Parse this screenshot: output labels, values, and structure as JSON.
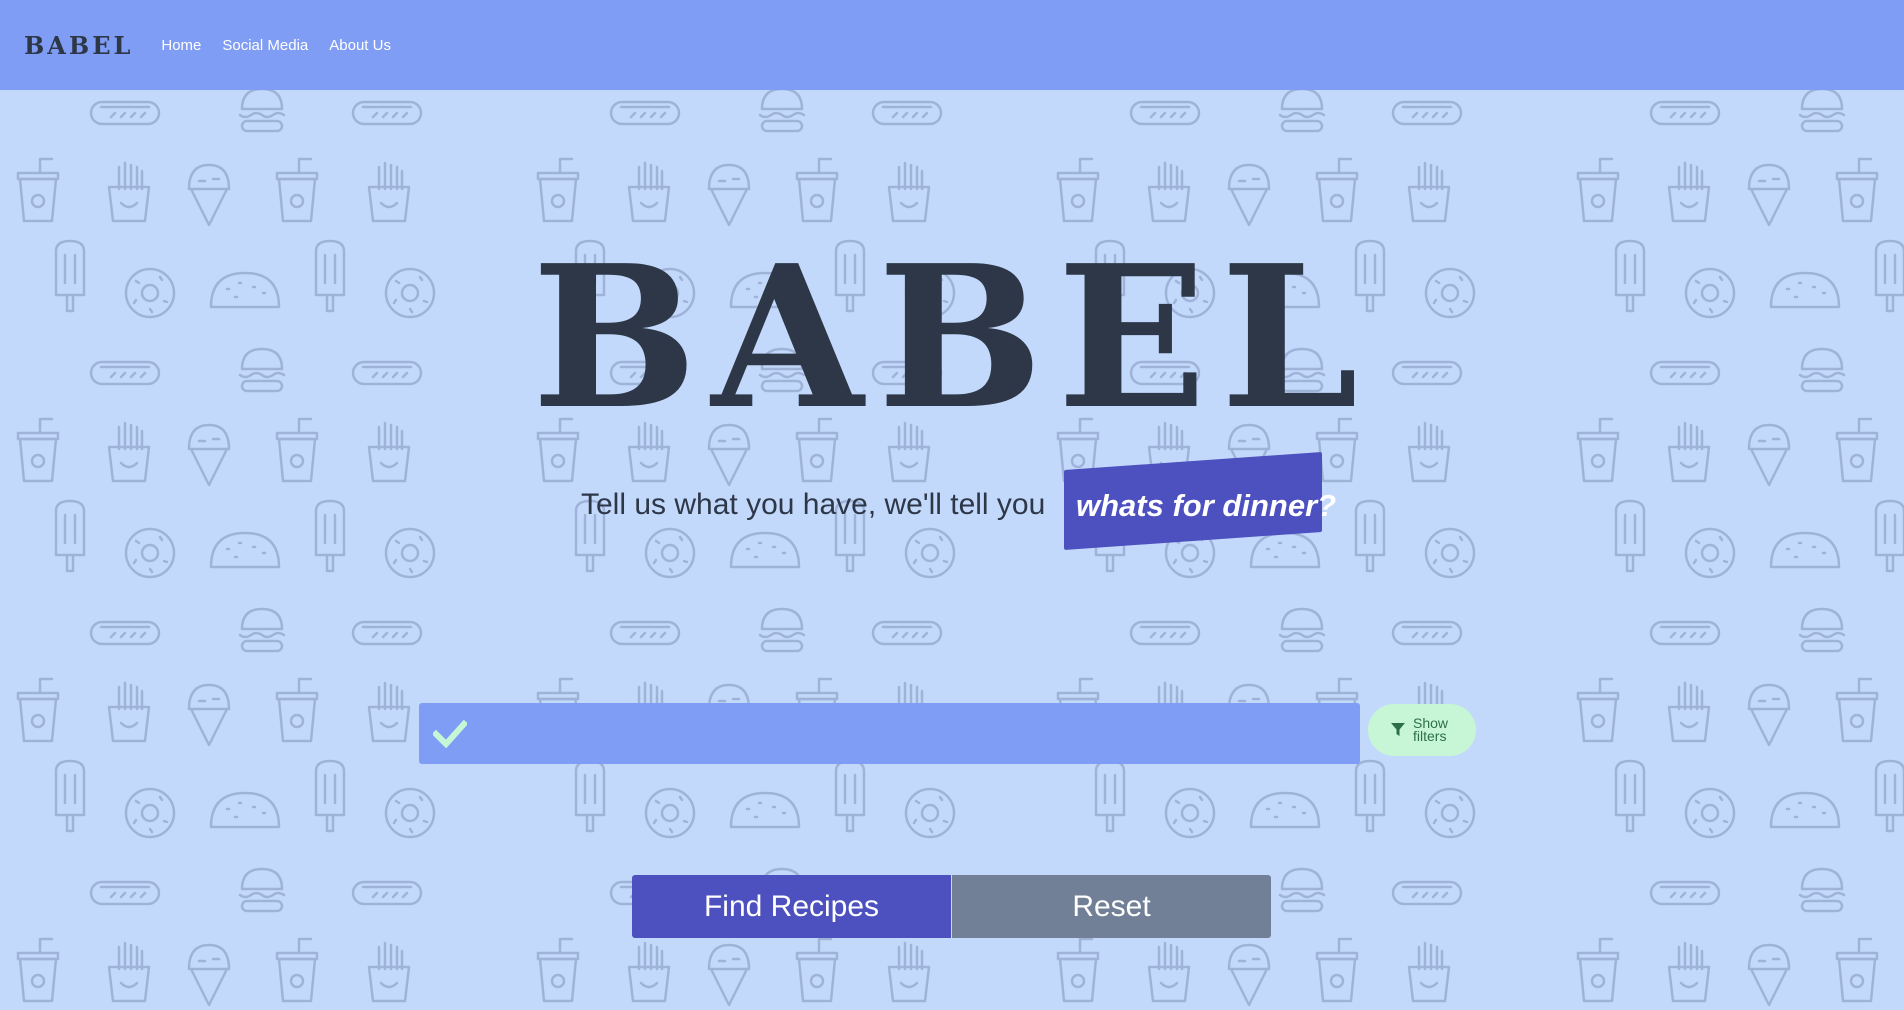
{
  "navbar": {
    "brand": "BABEL",
    "links": [
      "Home",
      "Social Media",
      "About Us"
    ]
  },
  "hero": {
    "title": "BABEL",
    "tagline": "Tell us what you have, we'll tell you",
    "tagline_highlight": "whats for dinner?"
  },
  "search": {
    "value": "",
    "placeholder": "",
    "icon": "check-icon"
  },
  "filters_button": {
    "label": "Show filters",
    "icon": "filter-icon"
  },
  "actions": {
    "find_label": "Find Recipes",
    "reset_label": "Reset"
  },
  "colors": {
    "background": "#c3d9fb",
    "navbar": "#7f9df4",
    "primary": "#4c51bf",
    "secondary": "#718096",
    "text_dark": "#2d3748",
    "filters_bg": "#c6f6d5",
    "check_icon": "#c6f6d5"
  },
  "background_pattern": [
    "hotdog-icon",
    "burger-icon",
    "soda-cup-icon",
    "fries-icon",
    "ice-cream-cone-icon",
    "popsicle-icon",
    "donut-icon",
    "taco-icon"
  ]
}
